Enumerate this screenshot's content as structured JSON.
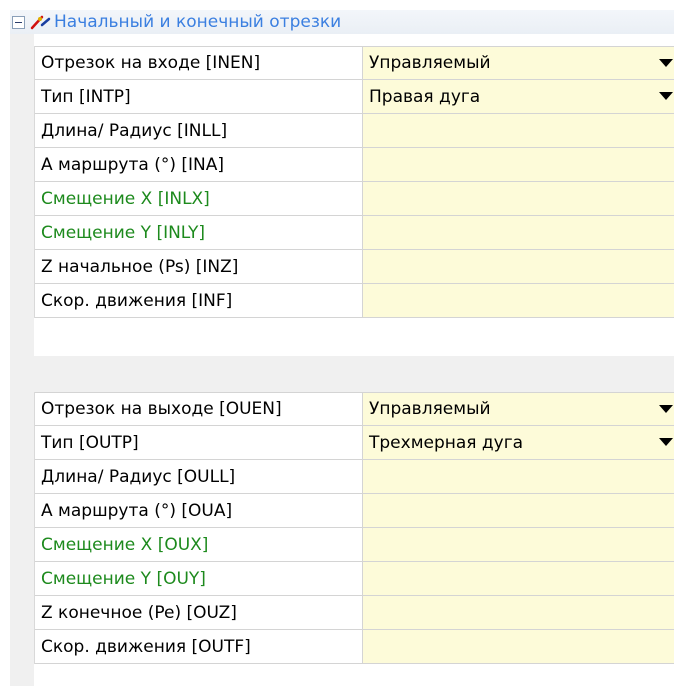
{
  "group": {
    "title": "Начальный и конечный отрезки",
    "icon": "lead-in-out-icon"
  },
  "lead_in": {
    "rows": [
      {
        "label": "Отрезок на входе [INEN]",
        "value": "Управляемый",
        "dropdown": true,
        "green": false
      },
      {
        "label": "Тип [INTP]",
        "value": "Правая дуга",
        "dropdown": true,
        "green": false
      },
      {
        "label": "Длина/ Радиус [INLL]",
        "value": "",
        "dropdown": false,
        "green": false
      },
      {
        "label": "A маршрута (°) [INA]",
        "value": "",
        "dropdown": false,
        "green": false
      },
      {
        "label": "Смещение X [INLX]",
        "value": "",
        "dropdown": false,
        "green": true
      },
      {
        "label": "Смещение Y [INLY]",
        "value": "",
        "dropdown": false,
        "green": true
      },
      {
        "label": "Z начальное (Ps) [INZ]",
        "value": "",
        "dropdown": false,
        "green": false
      },
      {
        "label": "Скор. движения [INF]",
        "value": "",
        "dropdown": false,
        "green": false
      }
    ]
  },
  "lead_out": {
    "rows": [
      {
        "label": "Отрезок на выходе [OUEN]",
        "value": "Управляемый",
        "dropdown": true,
        "green": false
      },
      {
        "label": "Тип [OUTP]",
        "value": "Трехмерная дуга",
        "dropdown": true,
        "green": false
      },
      {
        "label": "Длина/ Радиус [OULL]",
        "value": "",
        "dropdown": false,
        "green": false
      },
      {
        "label": "A маршрута (°) [OUA]",
        "value": "",
        "dropdown": false,
        "green": false
      },
      {
        "label": "Смещение X [OUX]",
        "value": "",
        "dropdown": false,
        "green": true
      },
      {
        "label": "Смещение Y [OUY]",
        "value": "",
        "dropdown": false,
        "green": true
      },
      {
        "label": "Z конечное (Pe) [OUZ]",
        "value": "",
        "dropdown": false,
        "green": false
      },
      {
        "label": "Скор. движения [OUTF]",
        "value": "",
        "dropdown": false,
        "green": false
      }
    ]
  },
  "colors": {
    "title": "#3b7fe0",
    "green_label": "#1d8a1d",
    "value_bg": "#fdfbd9"
  }
}
